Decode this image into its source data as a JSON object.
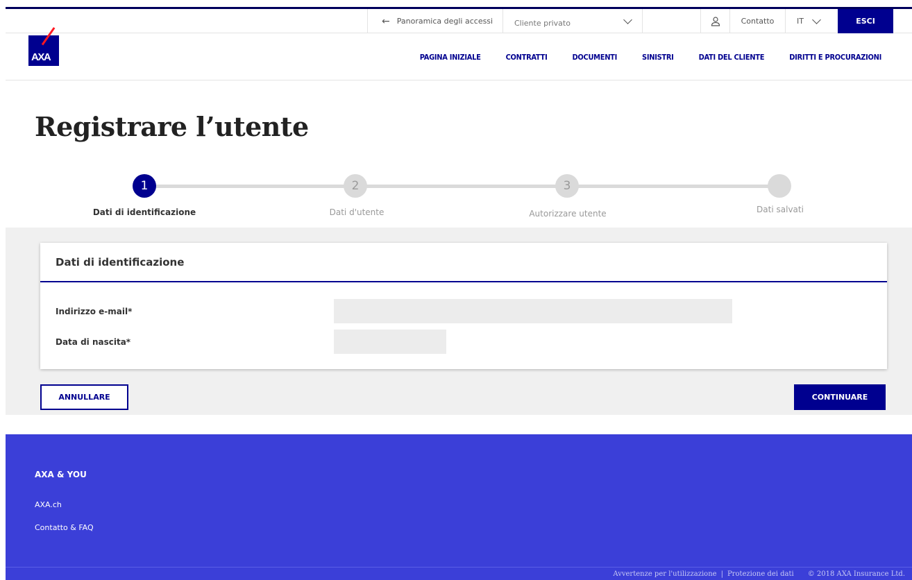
{
  "topbar": {
    "back_label": "Panoramica degli accessi",
    "client_select_value": "Cliente privato",
    "contact_label": "Contatto",
    "language": "IT",
    "logout_label": "ESCI"
  },
  "logo": {
    "text": "AXA",
    "brand_color": "#00008f",
    "accent_color": "#ff1721"
  },
  "nav": {
    "items": [
      {
        "label": "PAGINA INIZIALE"
      },
      {
        "label": "CONTRATTI"
      },
      {
        "label": "DOCUMENTI"
      },
      {
        "label": "SINISTRI"
      },
      {
        "label": "DATI DEL CLIENTE"
      },
      {
        "label": "DIRITTI E PROCURAZIONI"
      }
    ]
  },
  "page_title": "Registrare l’utente",
  "stepper": {
    "steps": [
      {
        "number": "1",
        "label": "Dati di identificazione",
        "active": true
      },
      {
        "number": "2",
        "label": "Dati d'utente",
        "active": false
      },
      {
        "number": "3",
        "label": "Autorizzare utente",
        "active": false
      },
      {
        "number": "",
        "label": "Dati salvati",
        "active": false
      }
    ]
  },
  "form": {
    "card_title": "Dati di identificazione",
    "email_label": "Indirizzo e-mail*",
    "email_value": "",
    "birthdate_label": "Data di nascita*",
    "birthdate_value": ""
  },
  "actions": {
    "cancel_label": "ANNULLARE",
    "continue_label": "CONTINUARE"
  },
  "footer": {
    "title": "AXA & YOU",
    "link1": "AXA.ch",
    "link2": "Contatto & FAQ",
    "legal1": "Avvertenze per l'utilizzazione",
    "separator": "|",
    "legal2": "Protezione dei dati",
    "copyright": "© 2018 AXA Insurance Ltd."
  },
  "colors": {
    "primary": "#00008f",
    "footer_bg": "#3b3fd8",
    "section_bg": "#f0f0f0"
  }
}
